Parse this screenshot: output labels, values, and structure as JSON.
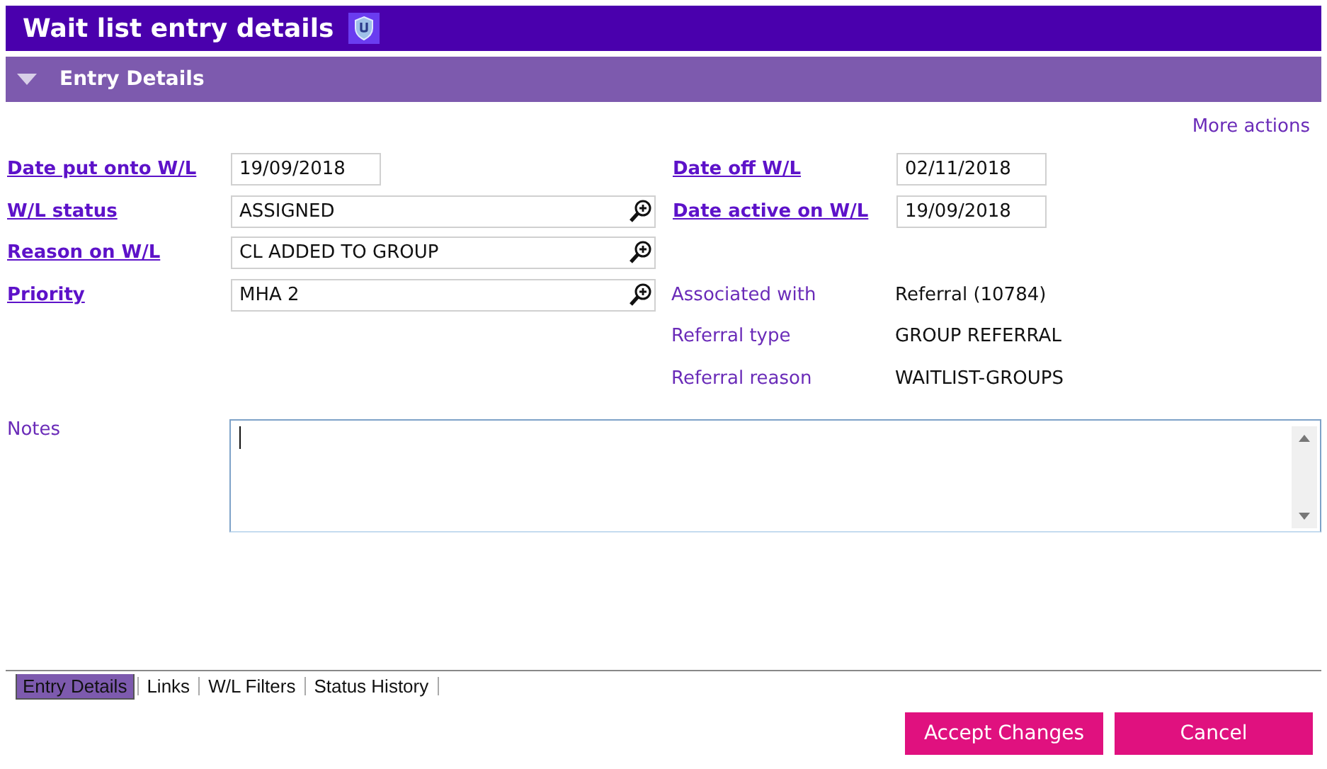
{
  "window": {
    "title": "Wait list entry details"
  },
  "section": {
    "title": "Entry Details",
    "expanded": true
  },
  "more_actions": "More actions",
  "left_fields": [
    {
      "label": "Date put onto W/L",
      "kind": "date",
      "value": "19/09/2018"
    },
    {
      "label": "W/L status",
      "kind": "lookup",
      "value": "ASSIGNED"
    },
    {
      "label": "Reason on W/L",
      "kind": "lookup",
      "value": "CL ADDED TO GROUP"
    },
    {
      "label": "Priority",
      "kind": "lookup",
      "value": "MHA 2"
    }
  ],
  "right_fields": [
    {
      "label": "Date off W/L",
      "kind": "date",
      "value": "02/11/2018"
    },
    {
      "label": "Date active on W/L",
      "kind": "date",
      "value": "19/09/2018"
    }
  ],
  "info": [
    {
      "label": "Associated with",
      "value": "Referral (10784)"
    },
    {
      "label": "Referral type",
      "value": "GROUP REFERRAL"
    },
    {
      "label": "Referral reason",
      "value": "WAITLIST-GROUPS"
    }
  ],
  "notes": {
    "label": "Notes"
  },
  "tabs": [
    {
      "label": "Entry Details",
      "selected": true
    },
    {
      "label": "Links",
      "selected": false
    },
    {
      "label": "W/L Filters",
      "selected": false
    },
    {
      "label": "Status History",
      "selected": false
    }
  ],
  "buttons": [
    "Accept Changes",
    "Cancel"
  ]
}
